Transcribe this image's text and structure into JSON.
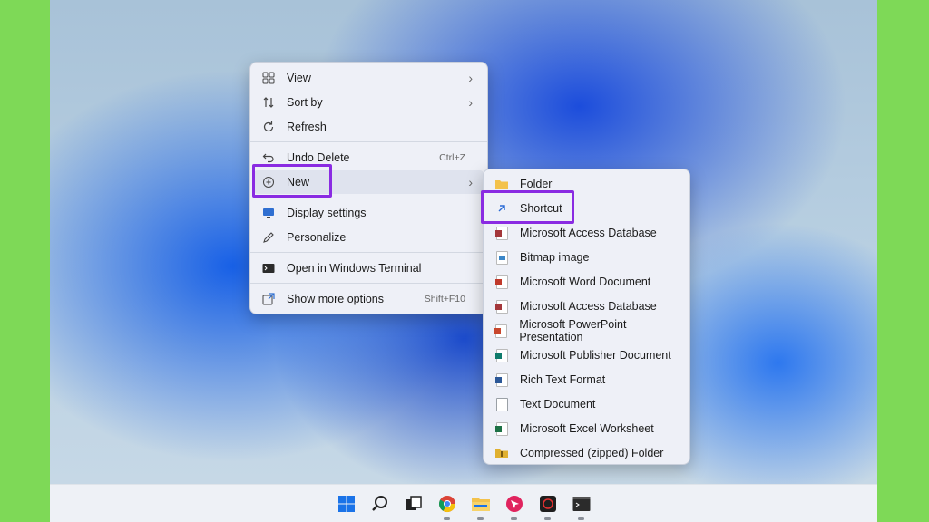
{
  "context_menu": {
    "items": [
      {
        "label": "View",
        "icon": "grid-icon"
      },
      {
        "label": "Sort by",
        "icon": "sort-icon"
      },
      {
        "label": "Refresh",
        "icon": "refresh-icon"
      },
      {
        "label": "Undo Delete",
        "icon": "undo-icon",
        "shortcut": "Ctrl+Z"
      },
      {
        "label": "New",
        "icon": "new-plus-icon"
      },
      {
        "label": "Display settings",
        "icon": "display-icon"
      },
      {
        "label": "Personalize",
        "icon": "pen-icon"
      },
      {
        "label": "Open in Windows Terminal",
        "icon": "terminal-icon"
      },
      {
        "label": "Show more options",
        "icon": "more-options-icon",
        "shortcut": "Shift+F10"
      }
    ]
  },
  "new_submenu": {
    "items": [
      {
        "label": "Folder",
        "icon": "folder-icon",
        "color": "#f3c24b"
      },
      {
        "label": "Shortcut",
        "icon": "shortcut-arrow-icon",
        "color": "#2a6bd6"
      },
      {
        "label": "Microsoft Access Database",
        "icon": "access-icon",
        "color": "#a4373a"
      },
      {
        "label": "Bitmap image",
        "icon": "bitmap-icon",
        "color": "#3a86c8"
      },
      {
        "label": "Microsoft Word Document",
        "icon": "word-icon",
        "color": "#c0392b"
      },
      {
        "label": "Microsoft Access Database",
        "icon": "access-icon",
        "color": "#a4373a"
      },
      {
        "label": "Microsoft PowerPoint Presentation",
        "icon": "powerpoint-icon",
        "color": "#c8462c"
      },
      {
        "label": "Microsoft Publisher Document",
        "icon": "publisher-icon",
        "color": "#0f7b6c"
      },
      {
        "label": "Rich Text Format",
        "icon": "rtf-icon",
        "color": "#2b5797"
      },
      {
        "label": "Text Document",
        "icon": "text-doc-icon",
        "color": "#9aa0a6"
      },
      {
        "label": "Microsoft Excel Worksheet",
        "icon": "excel-icon",
        "color": "#1d7145"
      },
      {
        "label": "Compressed (zipped) Folder",
        "icon": "zip-folder-icon",
        "color": "#e0b030"
      }
    ]
  },
  "taskbar": {
    "icons": [
      "windows-start-icon",
      "search-icon",
      "task-view-icon",
      "chrome-icon",
      "file-explorer-icon",
      "cursor-app-icon",
      "dark-app-icon",
      "terminal-icon"
    ]
  },
  "colors": {
    "highlight": "#8a2be2",
    "accent": "#0078d4",
    "page_background": "#7ed957"
  }
}
